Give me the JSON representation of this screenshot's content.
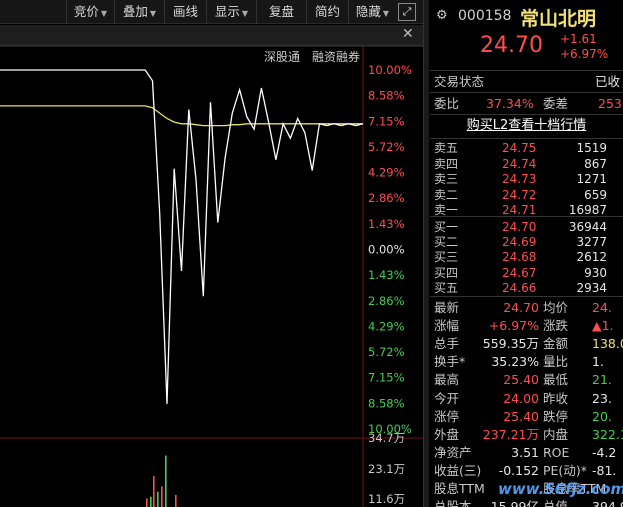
{
  "toolbar": {
    "buttons": [
      "竞价",
      "叠加",
      "画线",
      "显示",
      "复盘",
      "简约",
      "隐藏"
    ],
    "expand_icon": "expand-icon"
  },
  "subbar": {
    "close": "✕"
  },
  "tabs": {
    "shgt": "深股通",
    "rzrq": "融资融券"
  },
  "axis_right": [
    "10.00%",
    "8.58%",
    "7.15%",
    "5.72%",
    "4.29%",
    "2.86%",
    "1.43%",
    "0.00%",
    "1.43%",
    "2.86%",
    "4.29%",
    "5.72%",
    "7.15%",
    "8.58%",
    "10.00%"
  ],
  "volume_axis": [
    "34.7万",
    "23.1万",
    "11.6万"
  ],
  "colors": {
    "up": "#ff4d4d",
    "down": "#3fd14f",
    "avg_line": "#e8e25a",
    "price_line": "#ffffff"
  },
  "chart_data": {
    "type": "line",
    "title": "",
    "xlabel": "",
    "ylabel": "",
    "ylim": [
      -10.0,
      10.0
    ],
    "series": [
      {
        "name": "",
        "values": [
          10.0,
          10.0,
          10.0,
          10.0,
          10.0,
          10.0,
          10.0,
          10.0,
          10.0,
          10.0,
          10.0,
          10.0,
          10.0,
          10.0,
          10.0,
          10.0,
          10.0,
          10.0,
          10.0,
          10.0,
          10.0,
          9.4,
          2.0,
          -8.6,
          4.5,
          -1.2,
          7.8,
          3.9,
          -2.6,
          8.2,
          1.5,
          5.1,
          7.6,
          8.9,
          7.4,
          6.7,
          9.0,
          7.1,
          5.0,
          7.0,
          6.2,
          7.3,
          6.5,
          4.4,
          7.0,
          6.9,
          7.0,
          6.9,
          7.0,
          6.9,
          7.0
        ]
      },
      {
        "name": "",
        "values": [
          8.0,
          8.0,
          8.0,
          8.0,
          8.0,
          8.0,
          8.0,
          8.0,
          8.0,
          8.0,
          8.0,
          8.0,
          8.0,
          8.0,
          8.0,
          8.0,
          8.0,
          8.0,
          8.0,
          8.0,
          8.0,
          7.9,
          7.6,
          7.3,
          7.1,
          7.0,
          7.0,
          6.95,
          6.9,
          6.9,
          6.9,
          6.9,
          6.95,
          6.95,
          7.0,
          7.0,
          7.0,
          7.0,
          7.0,
          7.0,
          7.0,
          7.0,
          7.0,
          7.0,
          7.0,
          7.0,
          7.0,
          7.0,
          7.0,
          7.0,
          7.0
        ]
      }
    ],
    "volume": [
      0.05,
      0.06,
      0.18,
      0.09,
      0.12,
      0.3,
      0.07
    ]
  },
  "quote": {
    "code": "000158",
    "name": "常山北明",
    "price": "24.70",
    "change": "+1.61",
    "change_pct": "+6.97%",
    "status_label": "交易状态",
    "status_value": "已收",
    "weibi_label": "委比",
    "weibi_value": "37.34%",
    "weicha_label": "委差",
    "weicha_value": "253",
    "l2_link": "购买L2查看十档行情"
  },
  "orderbook": {
    "asks": [
      {
        "label": "卖五",
        "price": "24.75",
        "vol": "1519"
      },
      {
        "label": "卖四",
        "price": "24.74",
        "vol": "867"
      },
      {
        "label": "卖三",
        "price": "24.73",
        "vol": "1271"
      },
      {
        "label": "卖二",
        "price": "24.72",
        "vol": "659"
      },
      {
        "label": "卖一",
        "price": "24.71",
        "vol": "16987"
      }
    ],
    "bids": [
      {
        "label": "买一",
        "price": "24.70",
        "vol": "36944"
      },
      {
        "label": "买二",
        "price": "24.69",
        "vol": "3277"
      },
      {
        "label": "买三",
        "price": "24.68",
        "vol": "2612"
      },
      {
        "label": "买四",
        "price": "24.67",
        "vol": "930"
      },
      {
        "label": "买五",
        "price": "24.66",
        "vol": "2934"
      }
    ]
  },
  "stats": [
    {
      "l1": "最新",
      "v1": "24.70",
      "c1": "red",
      "l2": "均价",
      "v2": "24.",
      "c2": "red"
    },
    {
      "l1": "涨幅",
      "v1": "+6.97%",
      "c1": "red",
      "l2": "涨跌",
      "v2": "▲1.",
      "c2": "red"
    },
    {
      "l1": "总手",
      "v1": "559.35万",
      "c1": "wht",
      "l2": "金额",
      "v2": "138.05",
      "c2": "ylw"
    },
    {
      "l1": "换手*",
      "v1": "35.23%",
      "c1": "wht",
      "l2": "量比",
      "v2": "1.",
      "c2": "wht"
    },
    {
      "l1": "最高",
      "v1": "25.40",
      "c1": "red",
      "l2": "最低",
      "v2": "21.",
      "c2": "grn"
    },
    {
      "l1": "今开",
      "v1": "24.00",
      "c1": "red",
      "l2": "昨收",
      "v2": "23.",
      "c2": "wht"
    },
    {
      "l1": "涨停",
      "v1": "25.40",
      "c1": "red",
      "l2": "跌停",
      "v2": "20.",
      "c2": "grn"
    },
    {
      "l1": "外盘",
      "v1": "237.21万",
      "c1": "red",
      "l2": "内盘",
      "v2": "322.14",
      "c2": "grn"
    },
    {
      "l1": "净资产",
      "v1": "3.51",
      "c1": "wht",
      "l2": "ROE",
      "v2": "-4.2",
      "c2": "wht"
    },
    {
      "l1": "收益(三)",
      "v1": "-0.152",
      "c1": "wht",
      "l2": "PE(动)*",
      "v2": "-81.",
      "c2": "wht"
    },
    {
      "l1": "股息TTM",
      "v1": "",
      "c1": "wht",
      "l2": "股息率TTM",
      "v2": "",
      "c2": "wht"
    },
    {
      "l1": "总股本",
      "v1": "15.99亿",
      "c1": "wht",
      "l2": "总值",
      "v2": "394.9",
      "c2": "wht"
    }
  ],
  "watermark": "www.56fjz.com"
}
